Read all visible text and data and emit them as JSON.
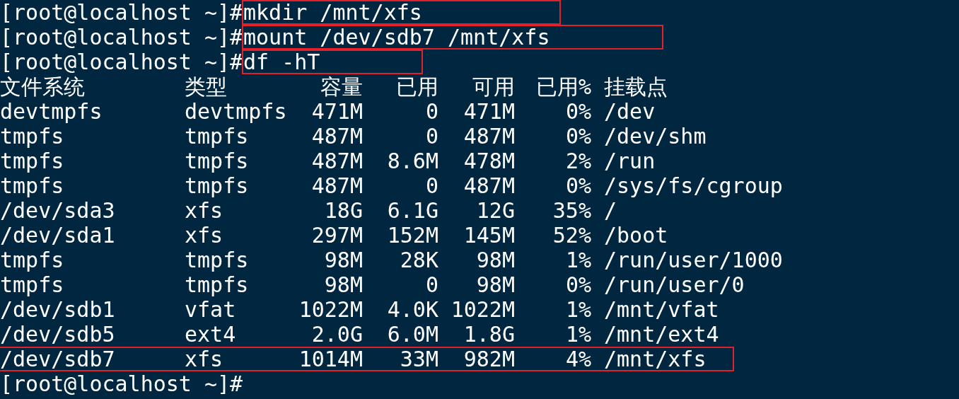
{
  "commands": [
    {
      "prompt": "[root@localhost ~]#",
      "command": "mkdir /mnt/xfs",
      "boxed": true
    },
    {
      "prompt": "[root@localhost ~]#",
      "command": "mount /dev/sdb7 /mnt/xfs",
      "boxed": true
    },
    {
      "prompt": "[root@localhost ~]#",
      "command": "df -hT",
      "boxed": true
    }
  ],
  "table": {
    "columns": [
      "文件系统",
      "类型",
      "容量",
      "已用",
      "可用",
      "已用%",
      "挂载点"
    ],
    "rows": [
      {
        "cells": [
          "devtmpfs",
          "devtmpfs",
          "471M",
          "0",
          "471M",
          "0%",
          "/dev"
        ],
        "boxed": false
      },
      {
        "cells": [
          "tmpfs",
          "tmpfs",
          "487M",
          "0",
          "487M",
          "0%",
          "/dev/shm"
        ],
        "boxed": false
      },
      {
        "cells": [
          "tmpfs",
          "tmpfs",
          "487M",
          "8.6M",
          "478M",
          "2%",
          "/run"
        ],
        "boxed": false
      },
      {
        "cells": [
          "tmpfs",
          "tmpfs",
          "487M",
          "0",
          "487M",
          "0%",
          "/sys/fs/cgroup"
        ],
        "boxed": false
      },
      {
        "cells": [
          "/dev/sda3",
          "xfs",
          "18G",
          "6.1G",
          "12G",
          "35%",
          "/"
        ],
        "boxed": false
      },
      {
        "cells": [
          "/dev/sda1",
          "xfs",
          "297M",
          "152M",
          "145M",
          "52%",
          "/boot"
        ],
        "boxed": false
      },
      {
        "cells": [
          "tmpfs",
          "tmpfs",
          "98M",
          "28K",
          "98M",
          "1%",
          "/run/user/1000"
        ],
        "boxed": false
      },
      {
        "cells": [
          "tmpfs",
          "tmpfs",
          "98M",
          "0",
          "98M",
          "0%",
          "/run/user/0"
        ],
        "boxed": false
      },
      {
        "cells": [
          "/dev/sdb1",
          "vfat",
          "1022M",
          "4.0K",
          "1022M",
          "1%",
          "/mnt/vfat"
        ],
        "boxed": false
      },
      {
        "cells": [
          "/dev/sdb5",
          "ext4",
          "2.0G",
          "6.0M",
          "1.8G",
          "1%",
          "/mnt/ext4"
        ],
        "boxed": false
      },
      {
        "cells": [
          "/dev/sdb7",
          "xfs",
          "1014M",
          "33M",
          "982M",
          "4%",
          "/mnt/xfs"
        ],
        "boxed": true
      }
    ]
  },
  "final_prompt": "[root@localhost ~]#"
}
